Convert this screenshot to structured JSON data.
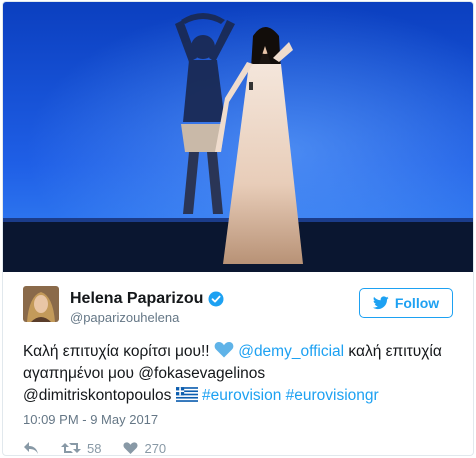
{
  "tweet": {
    "display_name": "Helena Paparizou",
    "handle": "@paparizouhelena",
    "follow_label": "Follow",
    "text_part1": "Καλή επιτυχία κορίτσι μου!! ",
    "mention1": "@demy_official",
    "text_part2": " καλή επιτυχία αγαπημένοι μου ",
    "mention2": "@fokasevagelinos",
    "mention3": "@dimitriskontopoulos",
    "hashtag1": "#eurovision",
    "hashtag2": "#eurovisiongr",
    "timestamp": "10:09 PM - 9 May 2017",
    "retweets": "58",
    "likes": "270",
    "accent_color": "#1da1f2"
  },
  "icons": {
    "verified": "verified-badge-icon",
    "reply": "reply-icon",
    "retweet": "retweet-icon",
    "like": "heart-icon",
    "bird": "twitter-bird-icon",
    "emoji_heart": "blue-heart-emoji",
    "flag": "greek-flag-emoji"
  }
}
